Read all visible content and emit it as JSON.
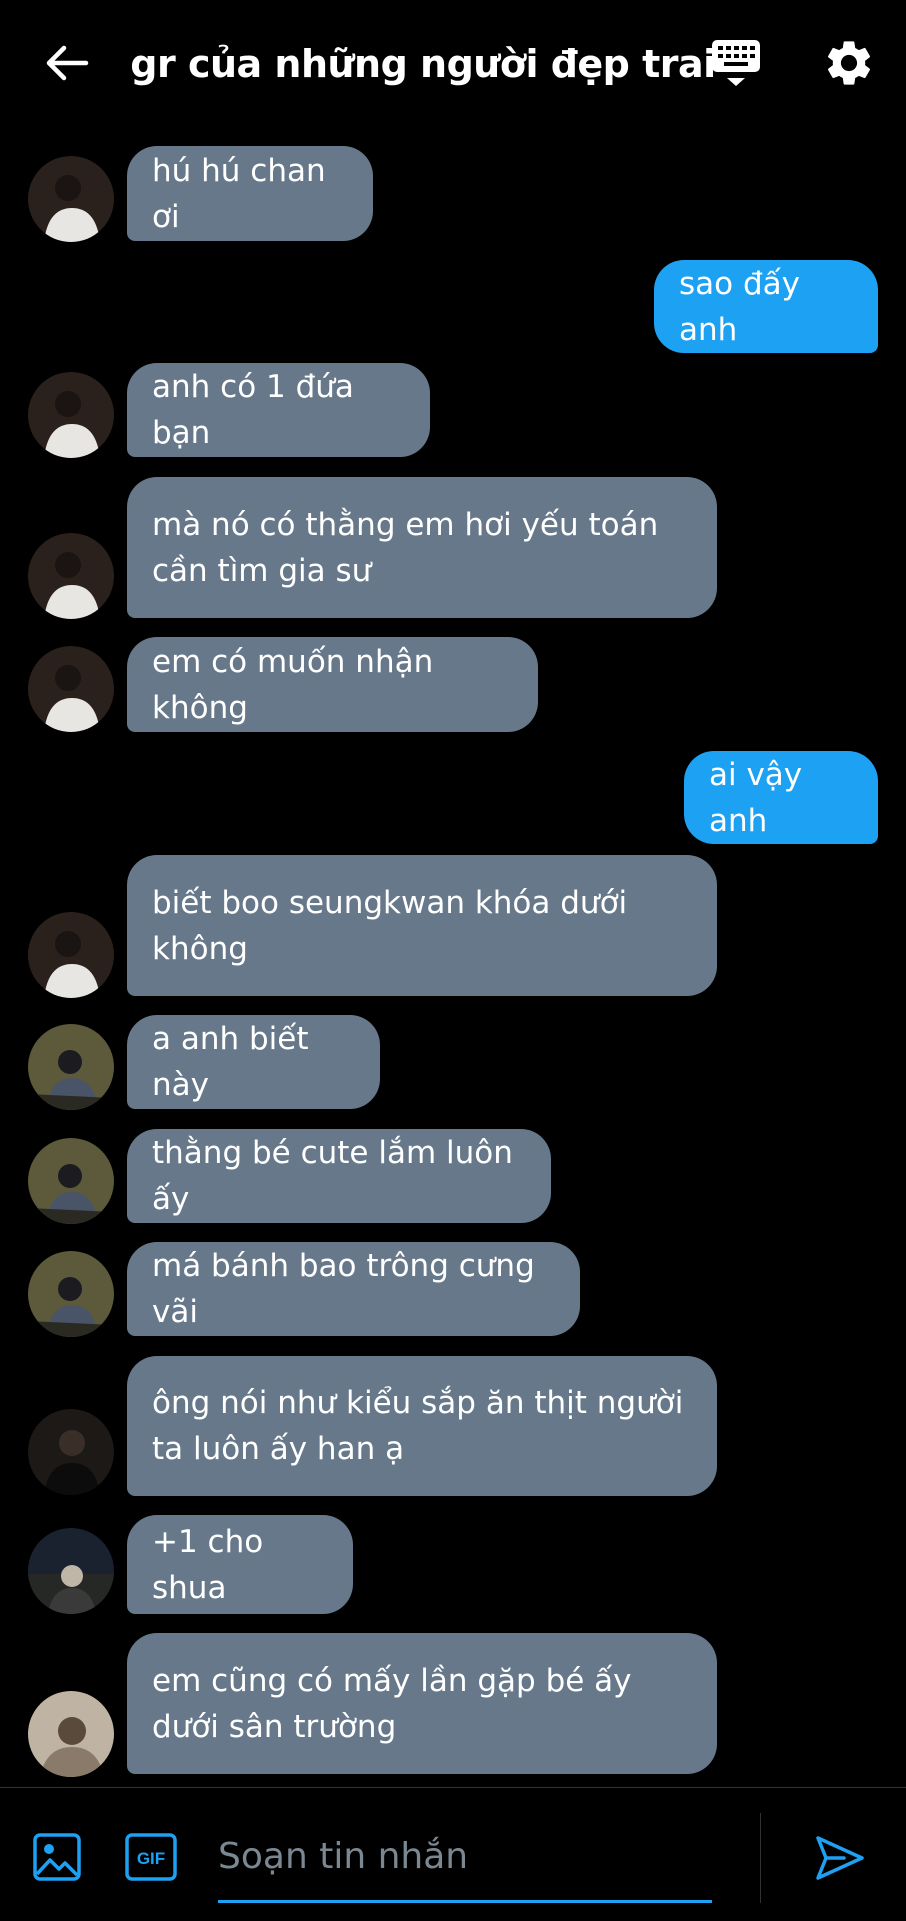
{
  "header": {
    "title": "gr của những người đẹp trai",
    "back_icon": "arrow-left-icon",
    "keyboard_icon": "keyboard-icon",
    "settings_icon": "gear-icon"
  },
  "messages": [
    {
      "text": "hú hú chan ơi",
      "dir": "in"
    },
    {
      "text": "sao đấy anh",
      "dir": "out"
    },
    {
      "text": "anh có 1 đứa bạn",
      "dir": "in"
    },
    {
      "text": "mà nó có thằng em hơi yếu toán cần tìm gia sư",
      "dir": "in"
    },
    {
      "text": "em có muốn nhận không",
      "dir": "in"
    },
    {
      "text": "ai vậy anh",
      "dir": "out"
    },
    {
      "text": "biết boo seungkwan khóa dưới không",
      "dir": "in"
    },
    {
      "text": "a anh biết này",
      "dir": "in"
    },
    {
      "text": "thằng bé cute lắm luôn ấy",
      "dir": "in"
    },
    {
      "text": "má bánh bao trông cưng vãi",
      "dir": "in"
    },
    {
      "text": "ông nói như kiểu sắp ăn thịt người ta luôn ấy han ạ",
      "dir": "in"
    },
    {
      "text": "+1 cho shua",
      "dir": "in"
    },
    {
      "text": "em cũng có mấy lần gặp bé ấy dưới sân trường",
      "dir": "in"
    }
  ],
  "composer": {
    "placeholder": "Soạn tin nhắn",
    "gif_label": "GIF",
    "image_icon": "image-icon",
    "send_icon": "send-icon"
  },
  "colors": {
    "incoming_bubble": "#66788a",
    "outgoing_bubble": "#1da1f2",
    "accent": "#1da1f2",
    "background": "#000000"
  }
}
